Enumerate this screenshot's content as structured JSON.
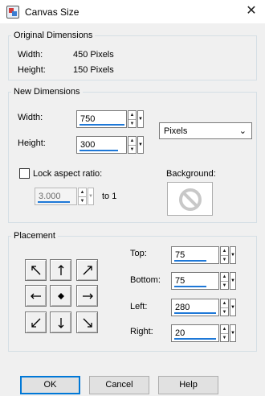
{
  "window": {
    "title": "Canvas Size",
    "close_glyph": "✕"
  },
  "original": {
    "legend": "Original Dimensions",
    "width_label": "Width:",
    "width_value": "450 Pixels",
    "height_label": "Height:",
    "height_value": "150 Pixels"
  },
  "new_dims": {
    "legend": "New Dimensions",
    "width_label": "Width:",
    "width_value": "750",
    "height_label": "Height:",
    "height_value": "300",
    "units_selected": "Pixels",
    "lock_label": "Lock aspect ratio:",
    "lock_checked": false,
    "ratio_value": "3.000",
    "ratio_suffix": "to 1",
    "background_label": "Background:",
    "background_icon": "no-color-icon"
  },
  "placement": {
    "legend": "Placement",
    "anchors": [
      "arrow-up-left-icon",
      "arrow-up-icon",
      "arrow-up-right-icon",
      "arrow-left-icon",
      "center-dot-icon",
      "arrow-right-icon",
      "arrow-down-left-icon",
      "arrow-down-icon",
      "arrow-down-right-icon"
    ],
    "top_label": "Top:",
    "top_value": "75",
    "bottom_label": "Bottom:",
    "bottom_value": "75",
    "left_label": "Left:",
    "left_value": "280",
    "right_label": "Right:",
    "right_value": "20"
  },
  "buttons": {
    "ok": "OK",
    "cancel": "Cancel",
    "help": "Help"
  },
  "colors": {
    "accent": "#0078d7",
    "field_underline": "#1e78d7",
    "no_color_icon": "#c8c8c8"
  }
}
